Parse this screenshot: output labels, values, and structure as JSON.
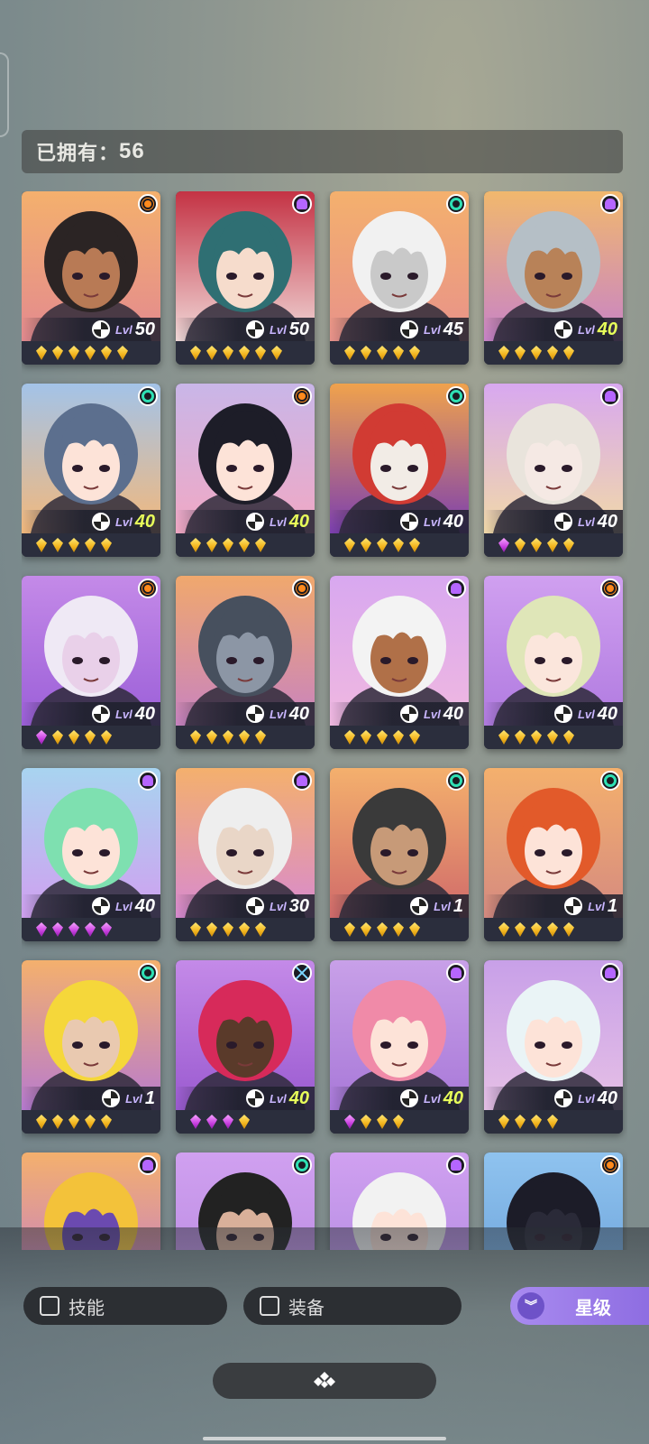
{
  "header": {
    "owned_label": "已拥有：",
    "owned_count": "56"
  },
  "level_prefix": "Lvl",
  "cards": [
    {
      "level": "50",
      "max": false,
      "faction": "sun",
      "stars": [
        "g",
        "g",
        "g",
        "g",
        "g",
        "g"
      ],
      "bg": [
        "#f4b06d",
        "#e38a8f"
      ],
      "hair": "#2b2424",
      "skin": "#b87a55"
    },
    {
      "level": "50",
      "max": false,
      "faction": "mystic",
      "stars": [
        "g",
        "g",
        "g",
        "g",
        "g",
        "g"
      ],
      "bg": [
        "#c43244",
        "#f1d9d8"
      ],
      "hair": "#2f6f73",
      "skin": "#f6dccc"
    },
    {
      "level": "45",
      "max": false,
      "faction": "spiral",
      "stars": [
        "g",
        "g",
        "g",
        "g",
        "g"
      ],
      "bg": [
        "#f4b06d",
        "#e8928a"
      ],
      "hair": "#f1f1f1",
      "skin": "#c9c9c9"
    },
    {
      "level": "40",
      "max": true,
      "faction": "mystic",
      "stars": [
        "g",
        "g",
        "g",
        "g",
        "g"
      ],
      "bg": [
        "#f1b86d",
        "#c883c8"
      ],
      "hair": "#b5bfc6",
      "skin": "#b88258"
    },
    {
      "level": "40",
      "max": true,
      "faction": "spiral",
      "stars": [
        "g",
        "g",
        "g",
        "g",
        "g"
      ],
      "bg": [
        "#a3c3e8",
        "#f2b87c"
      ],
      "hair": "#5c6f8e",
      "skin": "#fde3d8"
    },
    {
      "level": "40",
      "max": true,
      "faction": "sun",
      "stars": [
        "g",
        "g",
        "g",
        "g",
        "g"
      ],
      "bg": [
        "#c9b6e8",
        "#f1a8c4"
      ],
      "hair": "#1d1d28",
      "skin": "#fde3d8"
    },
    {
      "level": "40",
      "max": false,
      "faction": "spiral",
      "stars": [
        "g",
        "g",
        "g",
        "g",
        "g"
      ],
      "bg": [
        "#f0a24c",
        "#7c3fb0"
      ],
      "hair": "#d13b33",
      "skin": "#f2ece6"
    },
    {
      "level": "40",
      "max": false,
      "faction": "mystic",
      "stars": [
        "p",
        "g",
        "g",
        "g",
        "g"
      ],
      "bg": [
        "#d8a8f0",
        "#f1d9a8"
      ],
      "hair": "#e9e4dc",
      "skin": "#f5e9e4"
    },
    {
      "level": "40",
      "max": false,
      "faction": "sun",
      "stars": [
        "p",
        "g",
        "g",
        "g",
        "g"
      ],
      "bg": [
        "#c48ae8",
        "#9b5fd8"
      ],
      "hair": "#efe9f5",
      "skin": "#e9d0e9"
    },
    {
      "level": "40",
      "max": false,
      "faction": "sun",
      "stars": [
        "g",
        "g",
        "g",
        "g",
        "g"
      ],
      "bg": [
        "#f0a86d",
        "#c883c0"
      ],
      "hair": "#47505e",
      "skin": "#8c96a5"
    },
    {
      "level": "40",
      "max": false,
      "faction": "mystic",
      "stars": [
        "g",
        "g",
        "g",
        "g",
        "g"
      ],
      "bg": [
        "#d8a8f0",
        "#f0b8e0"
      ],
      "hair": "#f3f3f3",
      "skin": "#b07048"
    },
    {
      "level": "40",
      "max": false,
      "faction": "sun",
      "stars": [
        "g",
        "g",
        "g",
        "g",
        "g"
      ],
      "bg": [
        "#d0a0f0",
        "#b07ae0"
      ],
      "hair": "#dfe6b8",
      "skin": "#fbe6dc"
    },
    {
      "level": "40",
      "max": false,
      "faction": "mystic",
      "stars": [
        "p",
        "p",
        "p",
        "p",
        "p"
      ],
      "bg": [
        "#a8d4f0",
        "#d0a0f0"
      ],
      "hair": "#7ee0b0",
      "skin": "#fde3d8"
    },
    {
      "level": "30",
      "max": false,
      "faction": "mystic",
      "stars": [
        "g",
        "g",
        "g",
        "g",
        "g"
      ],
      "bg": [
        "#f4b06d",
        "#d88ad0"
      ],
      "hair": "#eeeeee",
      "skin": "#e9d6c7"
    },
    {
      "level": "1",
      "max": false,
      "faction": "spiral",
      "stars": [
        "g",
        "g",
        "g",
        "g",
        "g"
      ],
      "bg": [
        "#f4b06d",
        "#d06a6a"
      ],
      "hair": "#3a3a3a",
      "skin": "#c79a78"
    },
    {
      "level": "1",
      "max": false,
      "faction": "spiral",
      "stars": [
        "g",
        "g",
        "g",
        "g",
        "g"
      ],
      "bg": [
        "#f4b06d",
        "#d58a80"
      ],
      "hair": "#e25a2a",
      "skin": "#fde3d8"
    },
    {
      "level": "1",
      "max": false,
      "faction": "spiral",
      "stars": [
        "g",
        "g",
        "g",
        "g",
        "g"
      ],
      "bg": [
        "#f4b06d",
        "#b77ad0"
      ],
      "hair": "#f5d73a",
      "skin": "#e9c9b0"
    },
    {
      "level": "40",
      "max": true,
      "faction": "void",
      "stars": [
        "p",
        "p",
        "p",
        "g"
      ],
      "bg": [
        "#c48ae8",
        "#9a5ad0"
      ],
      "hair": "#d72a5a",
      "skin": "#5a3a2a"
    },
    {
      "level": "40",
      "max": true,
      "faction": "mystic",
      "stars": [
        "p",
        "g",
        "g",
        "g"
      ],
      "bg": [
        "#c8a0e8",
        "#a878d8"
      ],
      "hair": "#f08aa8",
      "skin": "#fde3d8"
    },
    {
      "level": "40",
      "max": false,
      "faction": "mystic",
      "stars": [
        "g",
        "g",
        "g",
        "g"
      ],
      "bg": [
        "#c8a0e8",
        "#e6c0e6"
      ],
      "hair": "#eaf4f6",
      "skin": "#fde3d8"
    },
    {
      "level": "",
      "max": false,
      "faction": "mystic",
      "stars": [],
      "bg": [
        "#f4b06d",
        "#c07ad0"
      ],
      "hair": "#f3c23a",
      "skin": "#6b4ab0"
    },
    {
      "level": "",
      "max": false,
      "faction": "spiral",
      "stars": [],
      "bg": [
        "#d0a0f0",
        "#b88ae0"
      ],
      "hair": "#222222",
      "skin": "#d9b09a"
    },
    {
      "level": "",
      "max": false,
      "faction": "mystic",
      "stars": [],
      "bg": [
        "#d0a0f0",
        "#b08ae0"
      ],
      "hair": "#f2f2f2",
      "skin": "#fde3d8"
    },
    {
      "level": "",
      "max": false,
      "faction": "sun",
      "stars": [],
      "bg": [
        "#8fc3ef",
        "#6aa0d8"
      ],
      "hair": "#1c1c28",
      "skin": "#2a2a38"
    }
  ],
  "filters": {
    "skill_label": "技能",
    "equip_label": "装备",
    "star_label": "星级"
  }
}
